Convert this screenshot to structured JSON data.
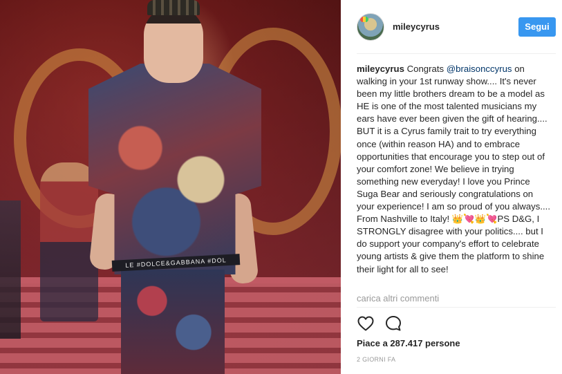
{
  "photo": {
    "band_text": "LE #DOLCE&GABBANA #DOL"
  },
  "post": {
    "username": "mileycyrus",
    "follow_label": "Segui",
    "caption": {
      "username": "mileycyrus",
      "before_mention": "Congrats ",
      "mention": "@braisonccyrus",
      "after_mention": " on walking in your 1st runway show.... It's never been my little brothers dream to be a model as HE is one of the most talented musicians my ears have ever been given the gift of hearing.... BUT it is a Cyrus family trait to try everything once (within reason HA) and to embrace opportunities that encourage you to step out of your comfort zone! We believe in trying something new everyday! I love you Prince Suga Bear and seriously congratulations on your experience! I am so proud of you always.... From Nashville to Italy! 👑💘👑💘PS D&G, I STRONGLY disagree with your politics.... but I do support your company's effort to celebrate young artists & give them the platform to shine their light for all to see!"
    },
    "load_more_comments": "carica altri commenti",
    "likes_text": "Piace a 287.417 persone",
    "timestamp": "2 GIORNI FA",
    "icons": {
      "like": "heart-icon",
      "comment": "comment-bubble-icon"
    }
  },
  "colors": {
    "follow_button": "#3897f0",
    "mention": "#003569",
    "muted_text": "#999999"
  }
}
